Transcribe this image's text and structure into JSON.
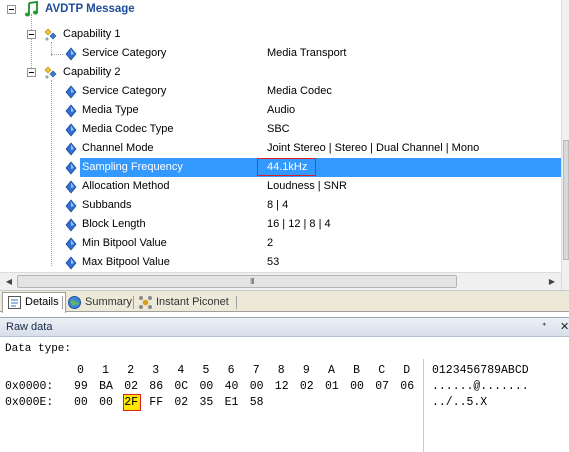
{
  "tree": {
    "root": {
      "label": "AVDTP Message"
    },
    "rows": [
      {
        "label": "Capability 1",
        "value": ""
      },
      {
        "label": "Service Category",
        "value": "Media Transport"
      },
      {
        "label": "Capability 2",
        "value": ""
      },
      {
        "label": "Service Category",
        "value": "Media Codec"
      },
      {
        "label": "Media Type",
        "value": "Audio"
      },
      {
        "label": "Media Codec Type",
        "value": "SBC"
      },
      {
        "label": "Channel Mode",
        "value": "Joint Stereo | Stereo | Dual Channel | Mono"
      },
      {
        "label": "Sampling Frequency",
        "value": "44.1kHz"
      },
      {
        "label": "Allocation Method",
        "value": "Loudness | SNR"
      },
      {
        "label": "Subbands",
        "value": "8 | 4"
      },
      {
        "label": "Block Length",
        "value": "16 | 12 | 8 | 4"
      },
      {
        "label": "Min Bitpool Value",
        "value": "2"
      },
      {
        "label": "Max Bitpool Value",
        "value": "53"
      }
    ],
    "selected_row_index": 7
  },
  "scrollbar": {
    "left_arrow": "◀",
    "right_arrow": "▶",
    "grip": "III"
  },
  "tabs": [
    {
      "label": "Details",
      "active": true
    },
    {
      "label": "Summary",
      "active": false
    },
    {
      "label": "Instant Piconet",
      "active": false
    }
  ],
  "raw_data": {
    "title": "Raw data",
    "pin_glyph": "ᐩ",
    "close_glyph": "✕",
    "data_type_label": "Data type:",
    "column_headers": [
      "0",
      "1",
      "2",
      "3",
      "4",
      "5",
      "6",
      "7",
      "8",
      "9",
      "A",
      "B",
      "C",
      "D"
    ],
    "ascii_header": "0123456789ABCD",
    "rows": [
      {
        "offset": "0x0000:",
        "bytes": [
          "99",
          "BA",
          "02",
          "86",
          "0C",
          "00",
          "40",
          "00",
          "12",
          "02",
          "01",
          "00",
          "07",
          "06"
        ],
        "ascii": "......@......."
      },
      {
        "offset": "0x000E:",
        "bytes": [
          "00",
          "00",
          "2F",
          "FF",
          "02",
          "35",
          "E1",
          "58"
        ],
        "ascii": "../..5.X"
      }
    ],
    "cursor": {
      "row": 1,
      "byte_index": 2
    }
  },
  "colors": {
    "selection": "#3399ff",
    "highlight_box": "#e02020",
    "cursor_fill": "#ffe800",
    "title_text": "#1f4e99"
  },
  "icons": {
    "root": "music-note-icon",
    "capability": "capability-icon",
    "field": "blue-diamond-icon"
  }
}
